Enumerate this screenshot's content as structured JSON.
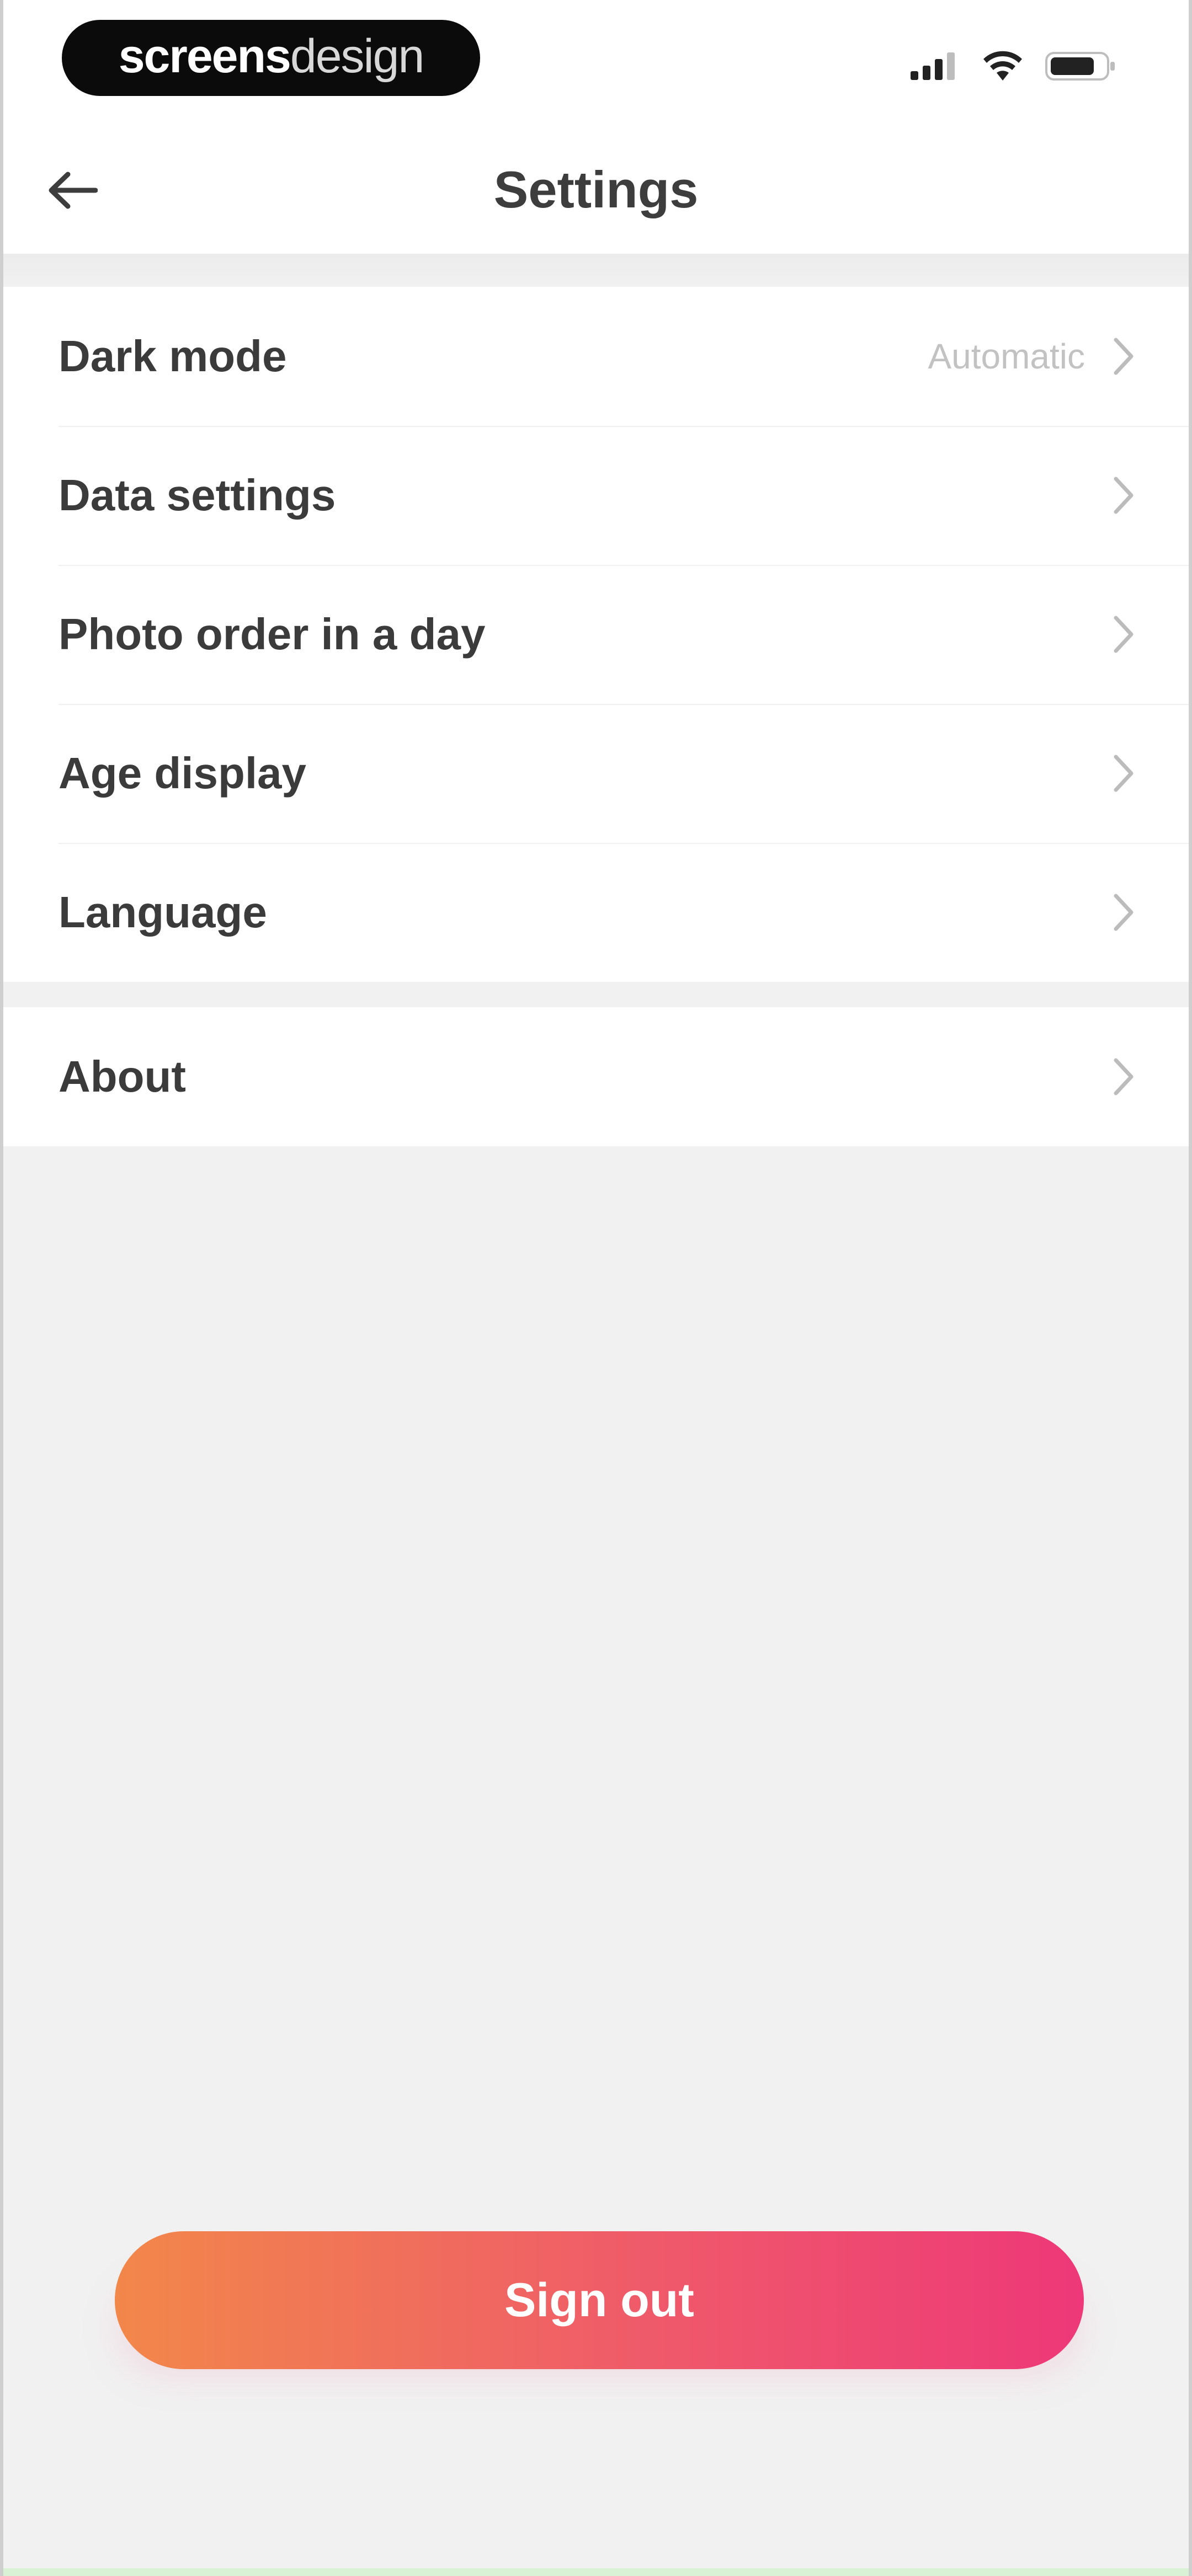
{
  "status_bar": {
    "brand_strong": "screens",
    "brand_light": "design",
    "icons": [
      "cellular-signal-icon",
      "wifi-icon",
      "battery-icon"
    ]
  },
  "header": {
    "title": "Settings",
    "back_icon": "arrow-left-icon"
  },
  "settings": {
    "group1": [
      {
        "label": "Dark mode",
        "value": "Automatic"
      },
      {
        "label": "Data settings"
      },
      {
        "label": "Photo order in a day"
      },
      {
        "label": "Age display"
      },
      {
        "label": "Language"
      }
    ],
    "group2": [
      {
        "label": "About"
      }
    ]
  },
  "actions": {
    "sign_out_label": "Sign out"
  },
  "colors": {
    "gradient_start": "#f2874a",
    "gradient_end": "#ee3878",
    "background": "#f1f1f1",
    "surface": "#ffffff"
  }
}
